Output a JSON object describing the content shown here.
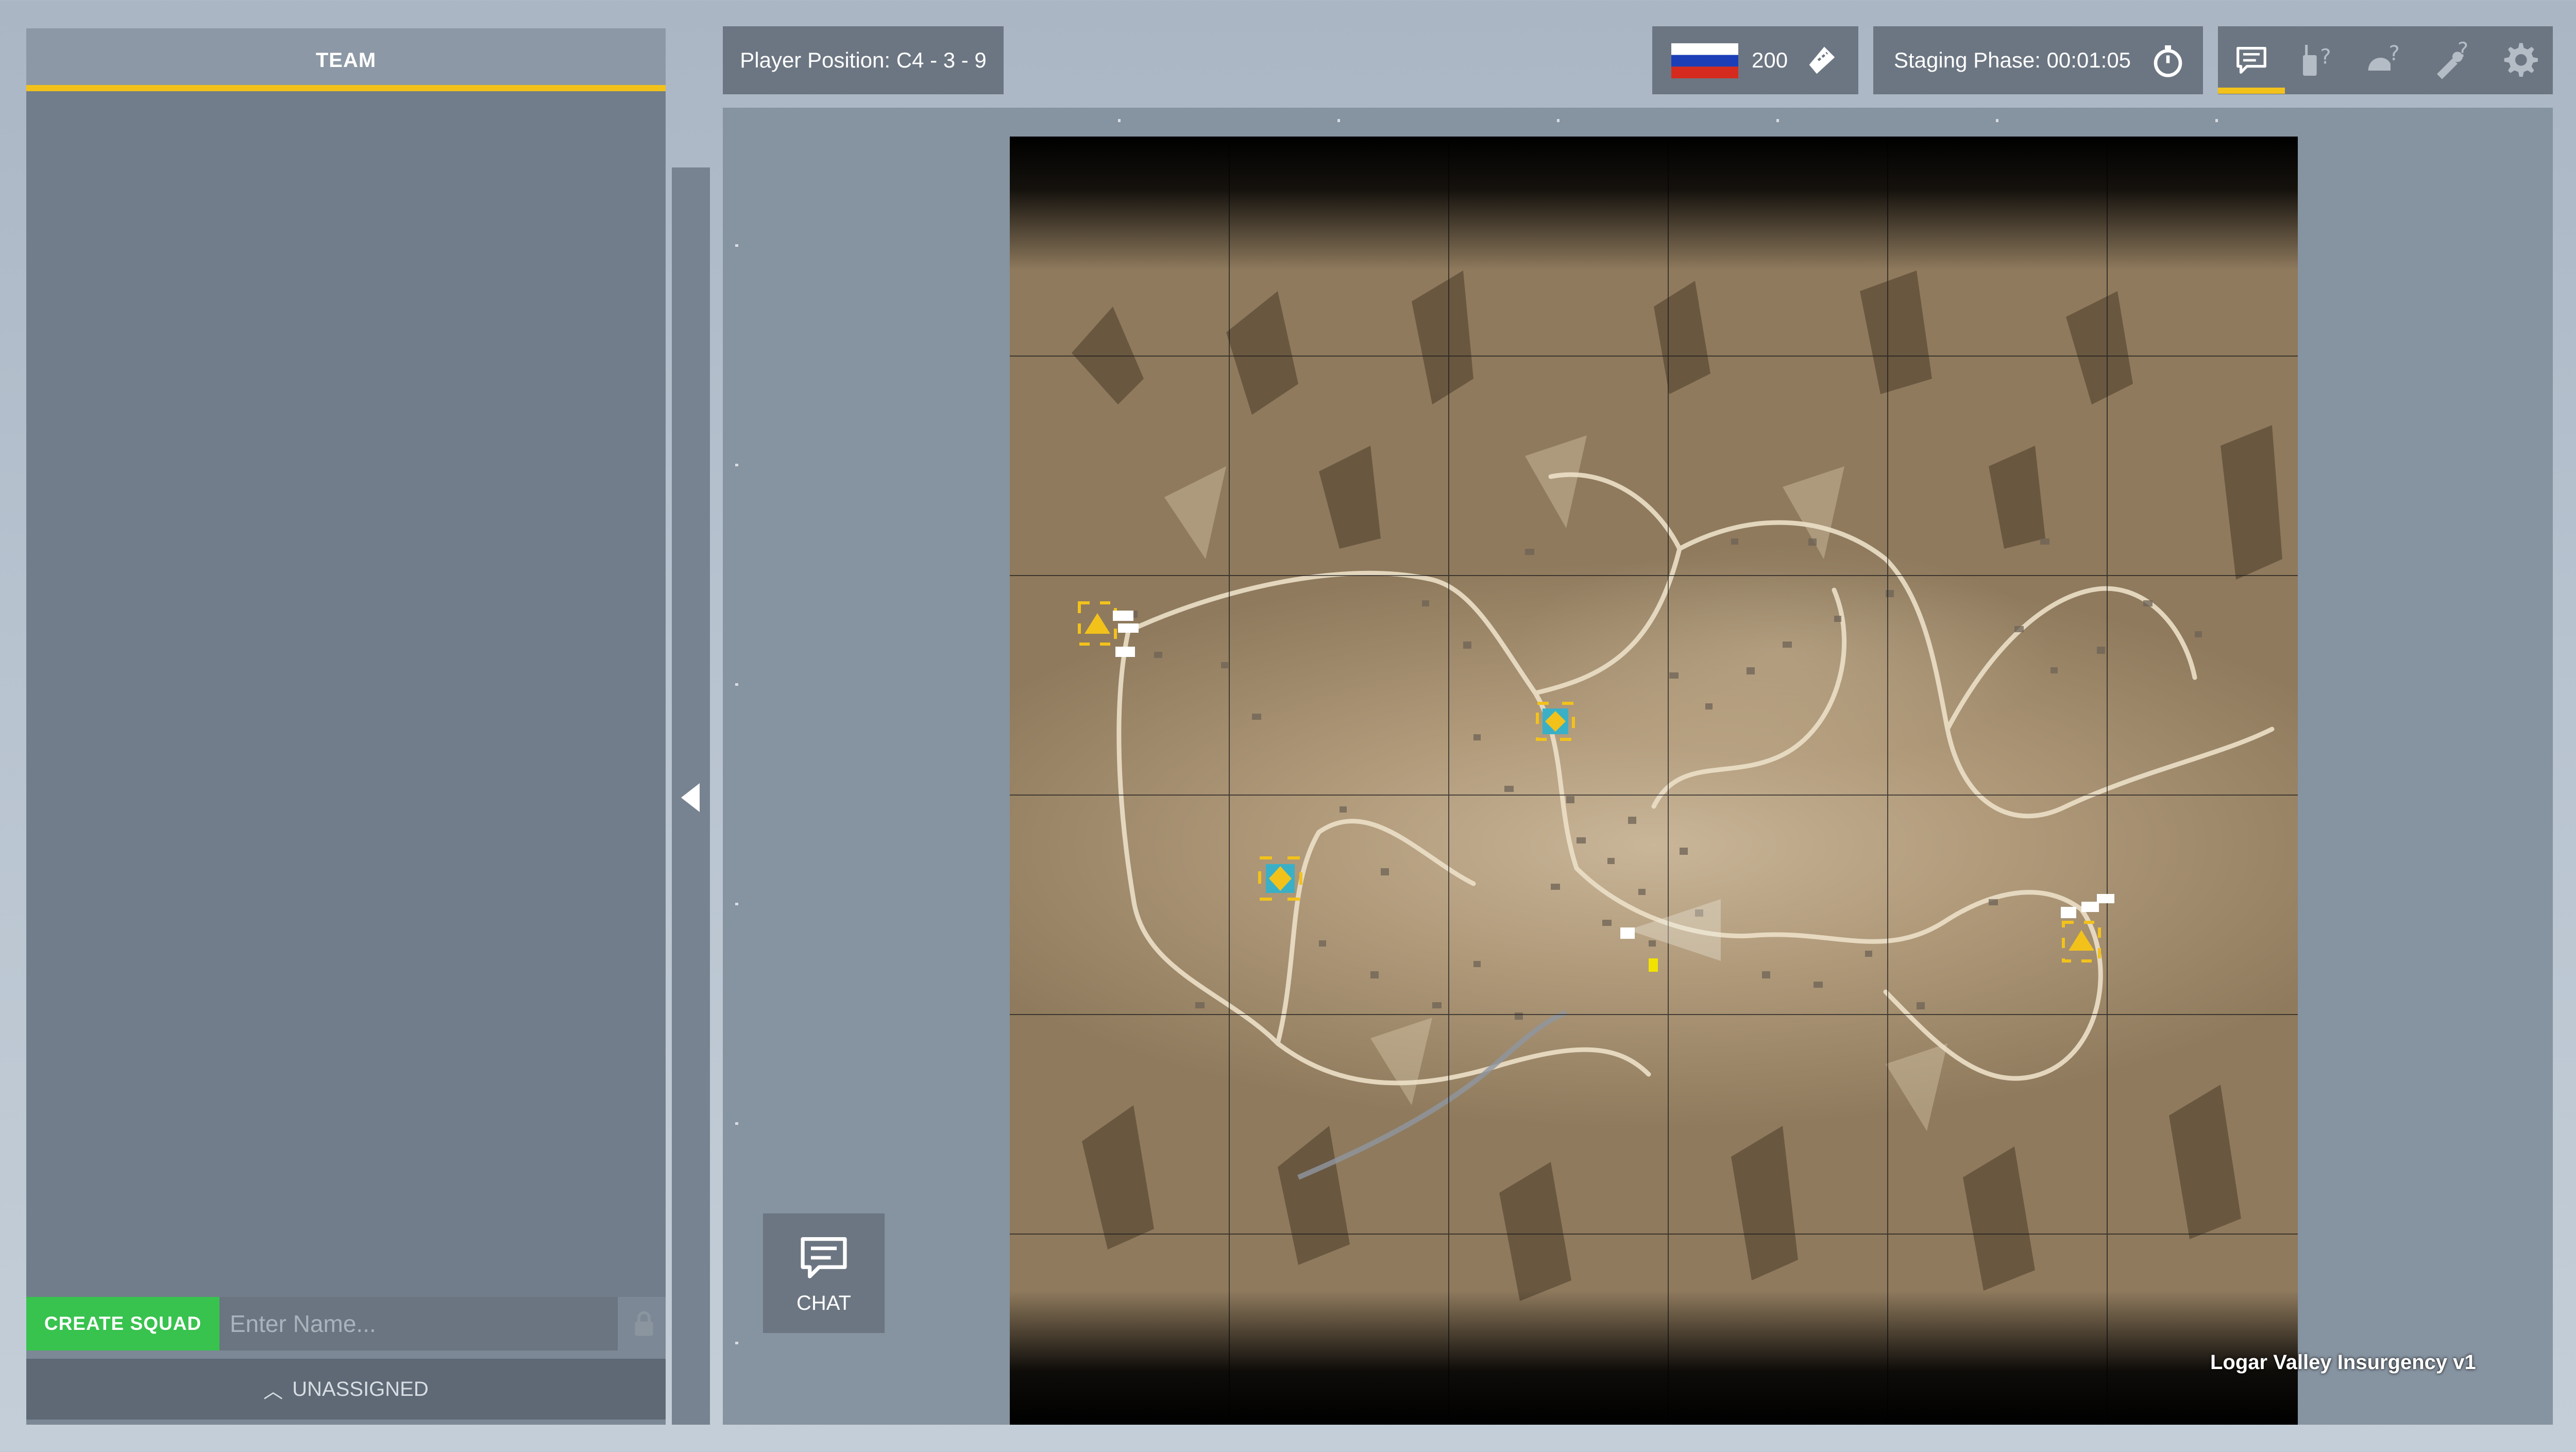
{
  "team_panel": {
    "header": "TEAM",
    "create_squad_label": "CREATE SQUAD",
    "squad_name_placeholder": "Enter Name...",
    "unassigned_label": "UNASSIGNED"
  },
  "topbar": {
    "player_position": "Player Position: C4 - 3 - 9",
    "tickets": "200",
    "staging_label": "Staging Phase:",
    "staging_time": "00:01:05",
    "flag": "russia-flag",
    "tools": [
      "chat-icon",
      "radio-help-icon",
      "helmet-help-icon",
      "wrench-help-icon",
      "gear-icon"
    ]
  },
  "map": {
    "title": "Logar Valley Insurgency v1",
    "grid": "5x5"
  },
  "chat_button": {
    "label": "CHAT"
  },
  "colors": {
    "accent": "#f2c21b",
    "create_squad": "#38c24e",
    "panel": "#717d8a",
    "box": "#6c7682"
  }
}
